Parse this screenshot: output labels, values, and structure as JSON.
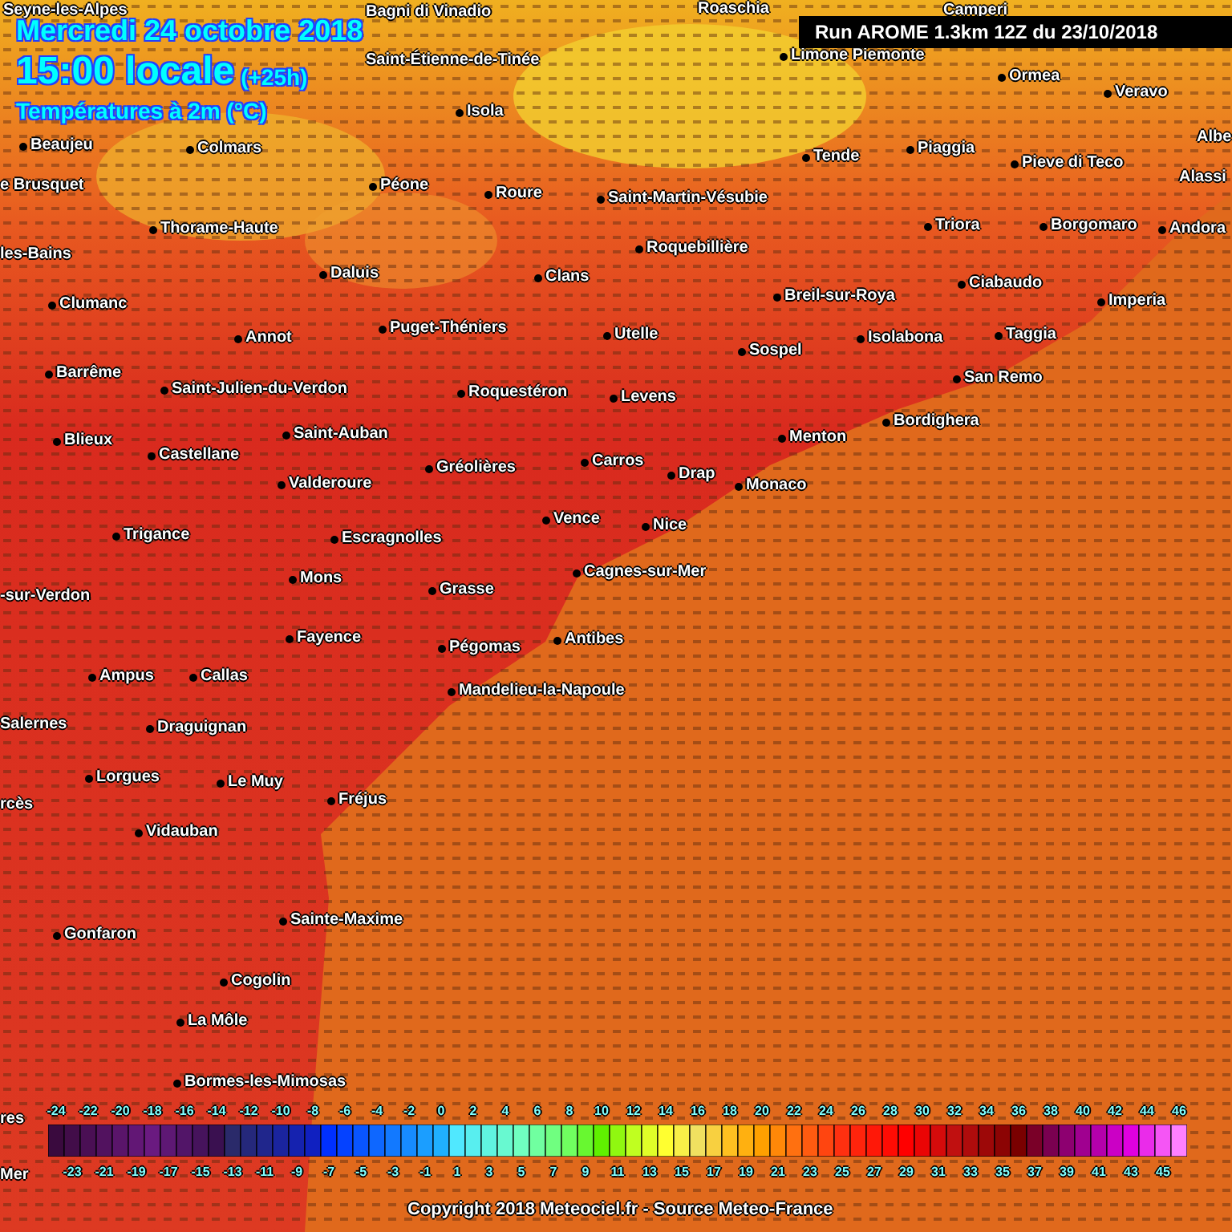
{
  "header": {
    "date": "Mercredi 24 octobre 2018",
    "time": "15:00 locale",
    "offset": "(+25h)",
    "variable": "Températures à 2m (°C)"
  },
  "run_label": "Run AROME 1.3km 12Z du 23/10/2018",
  "places": [
    "Seyne-les-Alpes",
    "Bagni di Vinadio",
    "Roaschia",
    "Camperi",
    "Saint-Étienne-de-Tinée",
    "Limone Piemonte",
    "Ormea",
    "Veravo",
    "Isola",
    "Beaujeu",
    "Colmars",
    "Tende",
    "Piaggia",
    "Pieve di Teco",
    "Albe",
    "e Brusquet",
    "Péone",
    "Roure",
    "Saint-Martin-Vésubie",
    "Alassi",
    "Thorame-Haute",
    "Triora",
    "Borgomaro",
    "Andora",
    "les-Bains",
    "Roquebillière",
    "Daluis",
    "Clans",
    "Ciabaudo",
    "Clumanc",
    "Breil-sur-Roya",
    "Imperia",
    "Annot",
    "Puget-Théniers",
    "Utelle",
    "Sospel",
    "Isolabona",
    "Taggia",
    "Barrême",
    "Saint-Julien-du-Verdon",
    "Roquestéron",
    "Levens",
    "San Remo",
    "Blieux",
    "Castellane",
    "Saint-Auban",
    "Menton",
    "Bordighera",
    "Valderoure",
    "Gréolières",
    "Carros",
    "Drap",
    "Monaco",
    "Trigance",
    "Escragnolles",
    "Vence",
    "Nice",
    "-sur-Verdon",
    "Mons",
    "Grasse",
    "Cagnes-sur-Mer",
    "Fayence",
    "Pégomas",
    "Antibes",
    "Ampus",
    "Callas",
    "Mandelieu-la-Napoule",
    "Salernes",
    "Draguignan",
    "Lorgues",
    "Le Muy",
    "rcès",
    "Fréjus",
    "Vidauban",
    "Gonfaron",
    "Sainte-Maxime",
    "Cogolin",
    "La Môle",
    "Bormes-les-Mimosas",
    "res",
    "Mer"
  ],
  "legend": {
    "top_labels": [
      "-24",
      "-22",
      "-20",
      "-18",
      "-16",
      "-14",
      "-12",
      "-10",
      "-8",
      "-6",
      "-4",
      "-2",
      "0",
      "2",
      "4",
      "6",
      "8",
      "10",
      "12",
      "14",
      "16",
      "18",
      "20",
      "22",
      "24",
      "26",
      "28",
      "30",
      "32",
      "34",
      "36",
      "38",
      "40",
      "42",
      "44",
      "46"
    ],
    "bottom_labels": [
      "-23",
      "-21",
      "-19",
      "-17",
      "-15",
      "-13",
      "-11",
      "-9",
      "-7",
      "-5",
      "-3",
      "-1",
      "1",
      "3",
      "5",
      "7",
      "9",
      "11",
      "13",
      "15",
      "17",
      "19",
      "21",
      "23",
      "25",
      "27",
      "29",
      "31",
      "33",
      "35",
      "37",
      "39",
      "41",
      "43",
      "45"
    ]
  },
  "copyright": "Copyright 2018 Meteociel.fr - Source Meteo-France"
}
